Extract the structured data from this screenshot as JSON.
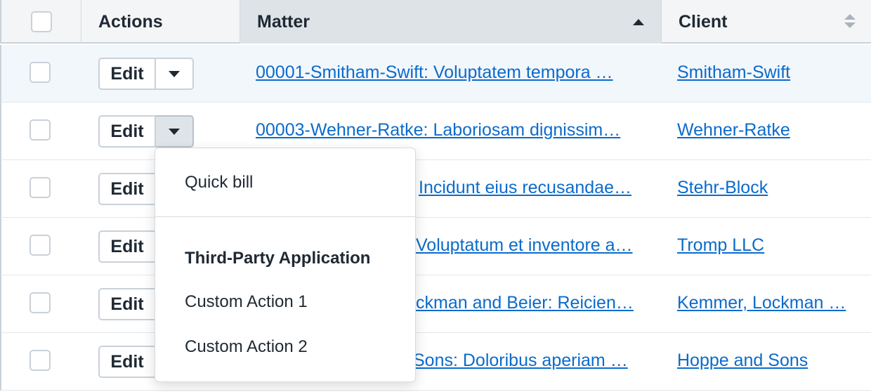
{
  "columns": {
    "actions": "Actions",
    "matter": "Matter",
    "client": "Client"
  },
  "rows": [
    {
      "edit": "Edit",
      "matter": "00001-Smitham-Swift: Voluptatem tempora …",
      "client": "Smitham-Swift"
    },
    {
      "edit": "Edit",
      "matter": "00003-Wehner-Ratke: Laboriosam dignissim…",
      "client": "Wehner-Ratke"
    },
    {
      "edit": "Edit",
      "matter": "Incidunt eius recusandae…",
      "client": "Stehr-Block"
    },
    {
      "edit": "Edit",
      "matter": "Voluptatum et inventore a…",
      "client": "Tromp LLC"
    },
    {
      "edit": "Edit",
      "matter": "ckman and Beier: Reicien…",
      "client": "Kemmer, Lockman …"
    },
    {
      "edit": "Edit",
      "matter": "Sons: Doloribus aperiam …",
      "client": "Hoppe and Sons"
    }
  ],
  "menu": {
    "quick_bill": "Quick bill",
    "section_heading": "Third-Party Application",
    "custom_action_1": "Custom Action 1",
    "custom_action_2": "Custom Action 2"
  },
  "colors": {
    "link": "#0b6bcb",
    "hover_row": "#f2f7fc",
    "sorted_header": "#dde3e7"
  },
  "icons": {
    "matter_sort": "sort-ascending-icon",
    "client_sort": "sort-unsorted-icon",
    "row_actions": "caret-down-icon"
  }
}
